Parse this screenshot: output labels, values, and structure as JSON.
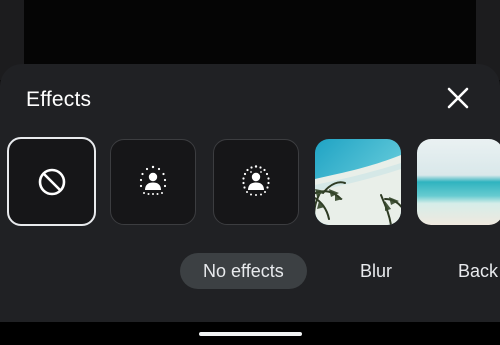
{
  "sheet": {
    "title": "Effects",
    "close_icon": "close-icon"
  },
  "effects": [
    {
      "id": "none",
      "icon": "no-effects-icon",
      "selected": true
    },
    {
      "id": "blur-light",
      "icon": "person-blur-light-icon",
      "selected": false
    },
    {
      "id": "blur-strong",
      "icon": "person-blur-strong-icon",
      "selected": false
    },
    {
      "id": "bg-palm-beach",
      "icon": "beach-palm-background",
      "selected": false
    },
    {
      "id": "bg-ocean",
      "icon": "ocean-background",
      "selected": false
    }
  ],
  "categories": {
    "no_effects": "No effects",
    "blur": "Blur",
    "backgrounds": "Back"
  },
  "colors": {
    "sheet_bg": "#202124",
    "tile_bg": "#161618",
    "active_chip_bg": "#3c4043",
    "text": "#e8eaed"
  }
}
